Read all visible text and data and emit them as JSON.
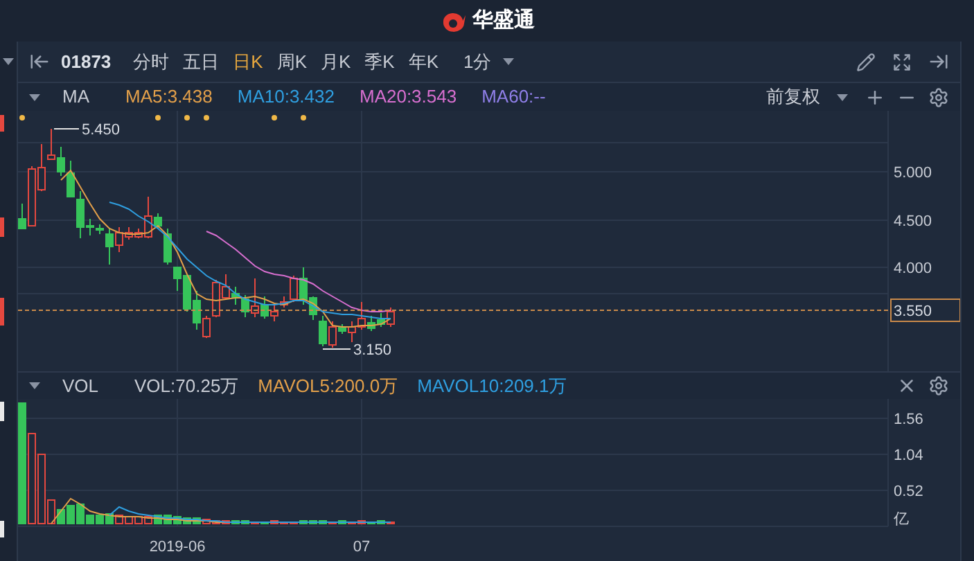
{
  "header": {
    "brand": "华盛通"
  },
  "toolbar": {
    "symbol": "01873",
    "periods": [
      {
        "label": "分时",
        "selected": false
      },
      {
        "label": "五日",
        "selected": false
      },
      {
        "label": "日K",
        "selected": true
      },
      {
        "label": "周K",
        "selected": false
      },
      {
        "label": "月K",
        "selected": false
      },
      {
        "label": "季K",
        "selected": false
      },
      {
        "label": "年K",
        "selected": false
      }
    ],
    "interval": "1分"
  },
  "price_panel": {
    "indicator": "MA",
    "values": [
      {
        "label": "MA5:3.438",
        "color": "#e3a04a"
      },
      {
        "label": "MA10:3.432",
        "color": "#2f9fe0"
      },
      {
        "label": "MA20:3.543",
        "color": "#d86fd0"
      },
      {
        "label": "MA60:--",
        "color": "#8f7fe8"
      }
    ],
    "adjust": "前复权",
    "high_label": "5.450",
    "low_label": "3.150",
    "current_price": "3.550",
    "y_ticks": [
      "5.000",
      "4.500",
      "4.000"
    ]
  },
  "volume_panel": {
    "indicator": "VOL",
    "values": [
      {
        "label": "VOL:70.25万",
        "color": "#c8ccd4"
      },
      {
        "label": "MAVOL5:200.0万",
        "color": "#e3a04a"
      },
      {
        "label": "MAVOL10:209.1万",
        "color": "#2f9fe0"
      }
    ],
    "y_ticks": [
      "1.56",
      "1.04",
      "0.52"
    ],
    "unit": "亿"
  },
  "x_axis": [
    "2019-06",
    "07"
  ]
}
